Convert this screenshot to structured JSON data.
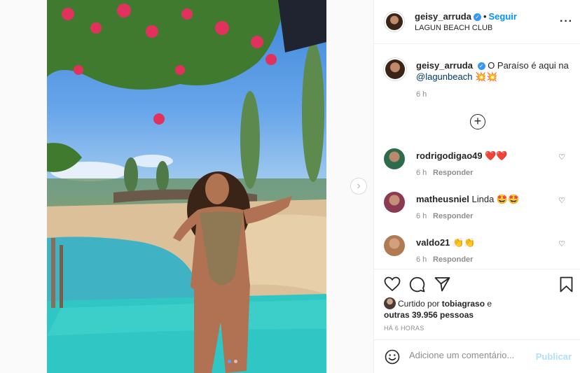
{
  "post": {
    "username": "geisy_arruda",
    "verified_mark": "✓",
    "separator": "•",
    "follow_label": "Seguir",
    "location": "LAGUN BEACH CLUB",
    "more_icon": "···",
    "photo_indicator": {
      "total": 2,
      "active_index": 1
    },
    "next_icon": "›"
  },
  "caption": {
    "username": "geisy_arruda",
    "text": "O Paraíso é aqui na",
    "mention": "@lagunbeach",
    "emoji": "💥💥",
    "time": "6 h"
  },
  "load_more_icon": "+",
  "comments": [
    {
      "username": "rodrigodigao49",
      "text": "❤️❤️",
      "time": "6 h",
      "reply": "Responder",
      "avatar_color": "#2d6b4b"
    },
    {
      "username": "matheusniel",
      "text": "Linda 🤩🤩",
      "time": "6 h",
      "reply": "Responder",
      "avatar_color": "#8a3b52"
    },
    {
      "username": "valdo21",
      "text": "👏👏",
      "time": "6 h",
      "reply": "Responder",
      "avatar_color": "#b07a52"
    }
  ],
  "comment_like_icon": "♡",
  "likes": {
    "prefix": "Curtido por",
    "user": "tobiagraso",
    "connector": "e",
    "others": "outras 39.956 pessoas"
  },
  "posted_ago": "HÁ 6 HORAS",
  "add_comment": {
    "placeholder": "Adicione um comentário...",
    "publish_label": "Publicar",
    "emoji_icon": "smiley-icon"
  },
  "colors": {
    "accent": "#0095f6",
    "verified": "#3897f0",
    "publish_disabled": "#b2dffc"
  }
}
